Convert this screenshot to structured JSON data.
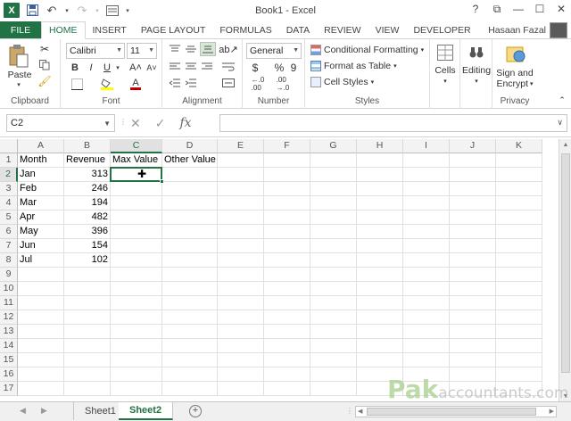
{
  "titlebar": {
    "title": "Book1 - Excel",
    "help": "?",
    "restore": "⧉",
    "minimize": "—",
    "maximize": "☐",
    "close": "✕"
  },
  "qat": {
    "logo": "X",
    "save_icon": "save-icon",
    "undo_icon": "undo-icon",
    "redo_icon": "redo-icon",
    "customize_icon": "customize-icon"
  },
  "tabs": {
    "file": "FILE",
    "items": [
      "HOME",
      "INSERT",
      "PAGE LAYOUT",
      "FORMULAS",
      "DATA",
      "REVIEW",
      "VIEW",
      "DEVELOPER"
    ],
    "user": "Hasaan Fazal"
  },
  "ribbon": {
    "clipboard": {
      "paste": "Paste",
      "label": "Clipboard"
    },
    "font": {
      "name": "Calibri",
      "size": "11",
      "bold": "B",
      "italic": "I",
      "underline": "U",
      "grow": "A˄",
      "shrink": "A˅",
      "label": "Font",
      "fill_color": "#ffff00",
      "font_color": "#c00000"
    },
    "alignment": {
      "label": "Alignment"
    },
    "number": {
      "format": "General",
      "currency": "$",
      "percent": "%",
      "comma": "9",
      "label": "Number"
    },
    "styles": {
      "conditional": "Conditional Formatting",
      "table": "Format as Table",
      "cell_styles": "Cell Styles",
      "label": "Styles"
    },
    "cells": {
      "label": "Cells"
    },
    "editing": {
      "label": "Editing"
    },
    "privacy": {
      "sign": "Sign and",
      "encrypt": "Encrypt",
      "label": "Privacy"
    }
  },
  "formula_bar": {
    "name_box": "C2",
    "cancel": "✕",
    "enter": "✓",
    "fx": "fx",
    "formula": ""
  },
  "grid": {
    "columns": [
      "A",
      "B",
      "C",
      "D",
      "E",
      "F",
      "G",
      "H",
      "I",
      "J",
      "K"
    ],
    "rows": [
      "1",
      "2",
      "3",
      "4",
      "5",
      "6",
      "7",
      "8",
      "9",
      "10",
      "11",
      "12",
      "13",
      "14",
      "15",
      "16",
      "17"
    ],
    "selected_column": "C",
    "selected_row": "2",
    "header": [
      "Month",
      "Revenue",
      "Max Value",
      "Other Value"
    ],
    "data": [
      [
        "Jan",
        "313"
      ],
      [
        "Feb",
        "246"
      ],
      [
        "Mar",
        "194"
      ],
      [
        "Apr",
        "482"
      ],
      [
        "May",
        "396"
      ],
      [
        "Jun",
        "154"
      ],
      [
        "Jul",
        "102"
      ]
    ]
  },
  "sheets": {
    "tabs": [
      "Sheet1",
      "Sheet2"
    ],
    "active": "Sheet2",
    "add": "+"
  },
  "watermark": {
    "brand": "Pak",
    "rest": "accountants.com"
  },
  "accent": "#217346"
}
